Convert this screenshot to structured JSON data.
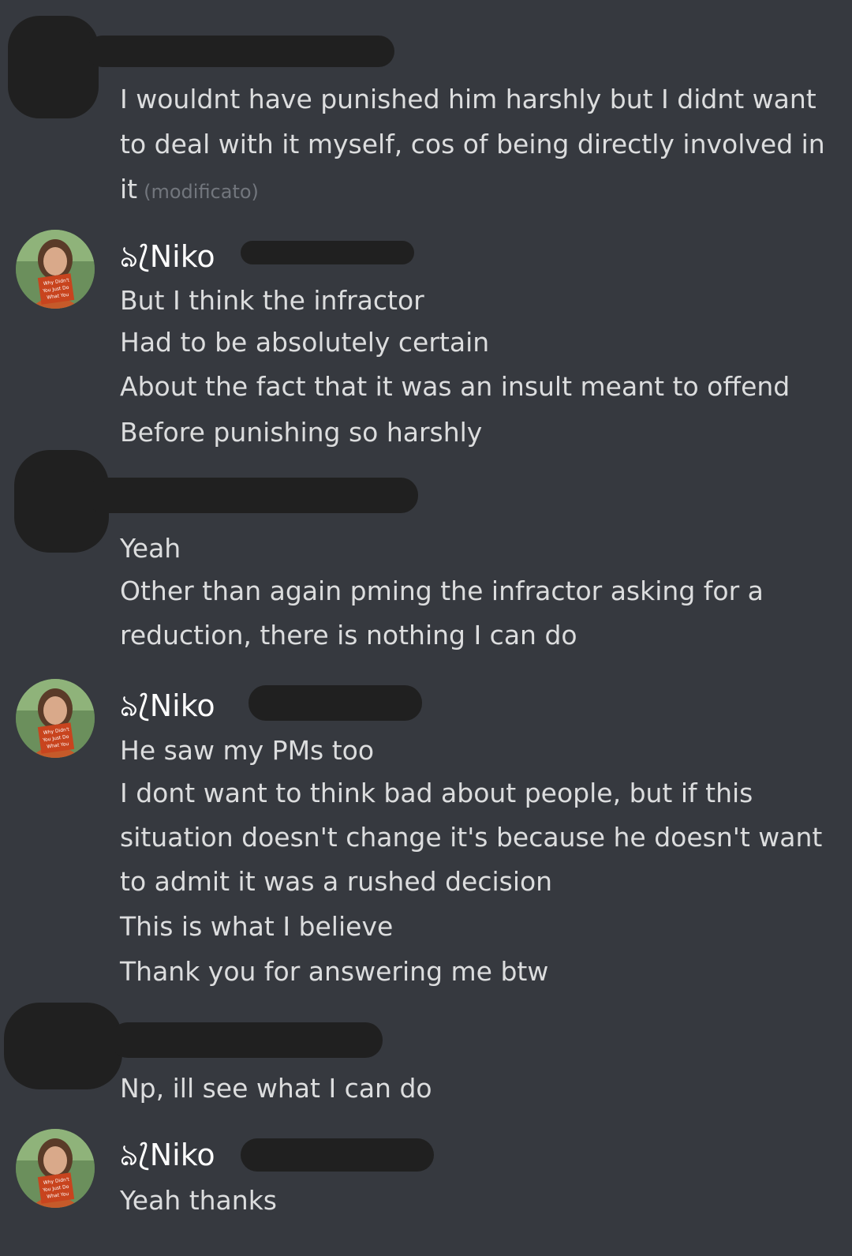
{
  "messages": [
    {
      "author": "",
      "lines": [
        "I wouldnt have punished him harshly but I didnt want",
        "to deal with it myself, cos of being directly involved in",
        "it"
      ],
      "edited_label": "(modificato)"
    },
    {
      "author": "ঌ⟅Niko",
      "lines": [
        "But I think the infractor",
        "Had to be absolutely certain",
        "About the fact that it was an insult meant to offend",
        "Before punishing so harshly"
      ]
    },
    {
      "author": "",
      "lines": [
        "Yeah",
        "Other than again pming the infractor asking for a",
        "reduction, there is nothing I can do"
      ]
    },
    {
      "author": "ঌ⟅Niko",
      "lines": [
        "He saw my PMs too",
        "I dont want to think bad about people, but if this",
        "situation doesn't change it's because he doesn't want",
        "to admit it was a rushed decision",
        "This is what I believe",
        "Thank you for answering me btw"
      ]
    },
    {
      "author": "",
      "lines": [
        "Np, ill see what I can do"
      ]
    },
    {
      "author": "ঌ⟅Niko",
      "lines": [
        "Yeah thanks"
      ]
    }
  ],
  "avatar": {
    "book_lines": [
      "Why Didn't",
      "You Just Do",
      "What You"
    ]
  },
  "colors": {
    "background": "#36393f",
    "text": "#dcddde",
    "username": "#ffffff",
    "muted": "#72767d",
    "redaction": "#202020"
  }
}
